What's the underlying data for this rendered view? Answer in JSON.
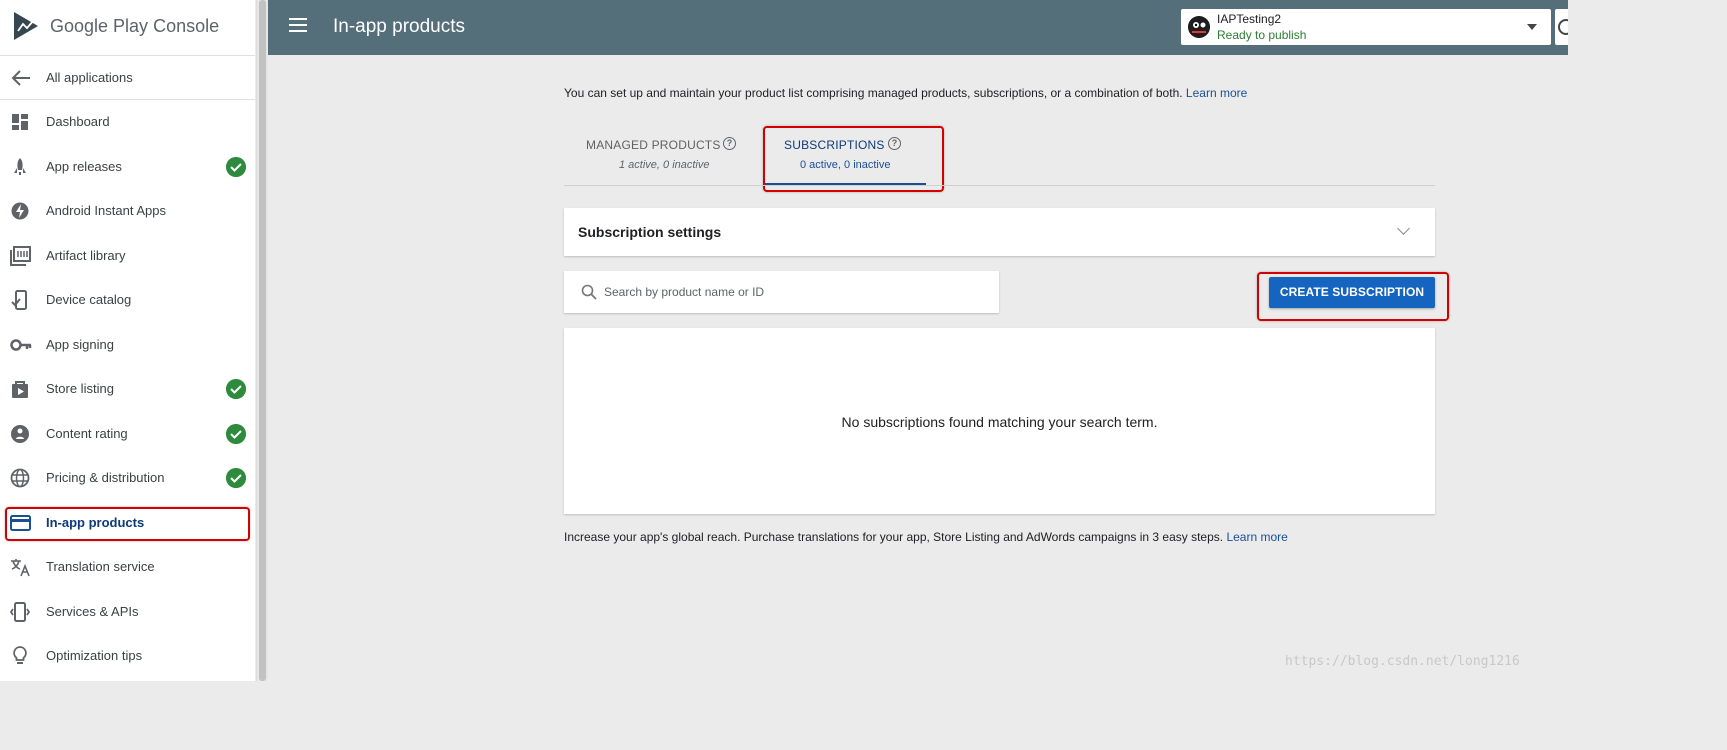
{
  "brand": {
    "name_google": "Google Play",
    "name_console": " Console"
  },
  "sidebar": {
    "back": "All applications",
    "items": [
      {
        "label": "Dashboard",
        "icon": "dashboard-icon",
        "check": false
      },
      {
        "label": "App releases",
        "icon": "rocket-icon",
        "check": true
      },
      {
        "label": "Android Instant Apps",
        "icon": "bolt-icon",
        "check": false
      },
      {
        "label": "Artifact library",
        "icon": "library-icon",
        "check": false
      },
      {
        "label": "Device catalog",
        "icon": "device-icon",
        "check": false
      },
      {
        "label": "App signing",
        "icon": "key-icon",
        "check": false
      },
      {
        "label": "Store listing",
        "icon": "shopping-bag-icon",
        "check": true
      },
      {
        "label": "Content rating",
        "icon": "rating-icon",
        "check": true
      },
      {
        "label": "Pricing & distribution",
        "icon": "globe-icon",
        "check": true
      },
      {
        "label": "In-app products",
        "icon": "credit-card-icon",
        "check": false,
        "active": true
      },
      {
        "label": "Translation service",
        "icon": "translate-icon",
        "check": false
      },
      {
        "label": "Services & APIs",
        "icon": "api-icon",
        "check": false
      },
      {
        "label": "Optimization tips",
        "icon": "lightbulb-icon",
        "check": false
      }
    ]
  },
  "header": {
    "title": "In-app products",
    "app": {
      "name": "IAPTesting2",
      "status": "Ready to publish"
    }
  },
  "main": {
    "intro": "You can set up and maintain your product list comprising managed products, subscriptions, or a combination of both.",
    "intro_link": "Learn more",
    "tabs": [
      {
        "label": "MANAGED PRODUCTS",
        "sub": "1 active, 0 inactive"
      },
      {
        "label": "SUBSCRIPTIONS",
        "sub": "0 active, 0 inactive",
        "selected": true
      }
    ],
    "settings_title": "Subscription settings",
    "search_placeholder": "Search by product name or ID",
    "create_label": "CREATE SUBSCRIPTION",
    "empty_message": "No subscriptions found matching your search term.",
    "footer_text": "Increase your app's global reach. Purchase translations for your app, Store Listing and AdWords campaigns in 3 easy steps.",
    "footer_link": "Learn more"
  },
  "watermark": "https://blog.csdn.net/long1216",
  "colors": {
    "topbar": "#546e7a",
    "accent": "#1565c0",
    "highlight": "#d40000",
    "check": "#2e8b3d"
  }
}
